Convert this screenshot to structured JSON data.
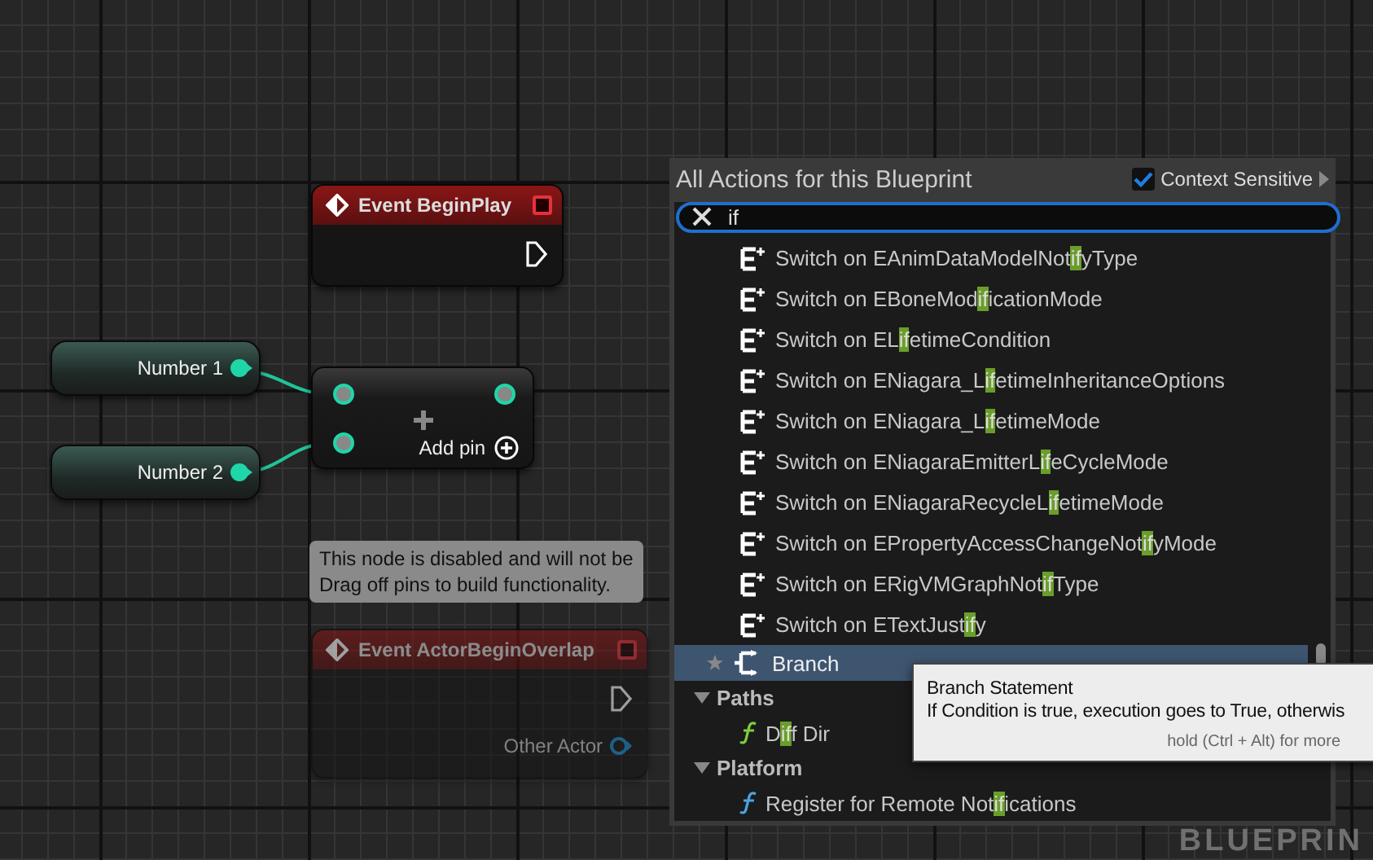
{
  "events": [
    {
      "title": "Event BeginPlay",
      "disabled": false
    },
    {
      "title": "Event ActorBeginOverlap",
      "disabled": true,
      "outputs": [
        "Other Actor"
      ]
    }
  ],
  "variables": [
    {
      "label": "Number 1"
    },
    {
      "label": "Number 2"
    }
  ],
  "add_node": {
    "label": "Add pin"
  },
  "disabled_note": {
    "lines": [
      "This node is disabled and will not be",
      "Drag off pins to build functionality."
    ]
  },
  "watermark": "BLUEPRIN",
  "action_menu": {
    "title": "All Actions for this Blueprint",
    "context_sensitive": {
      "label": "Context Sensitive",
      "checked": true
    },
    "search": {
      "value": "if"
    },
    "items": [
      {
        "kind": "switch",
        "selected": false,
        "parts": [
          "Switch on EAnimDataModelNot",
          "if",
          "yType"
        ]
      },
      {
        "kind": "switch",
        "selected": false,
        "parts": [
          "Switch on EBoneMod",
          "if",
          "icationMode"
        ]
      },
      {
        "kind": "switch",
        "selected": false,
        "parts": [
          "Switch on EL",
          "if",
          "etimeCondition"
        ]
      },
      {
        "kind": "switch",
        "selected": false,
        "parts": [
          "Switch on ENiagara_L",
          "if",
          "etimeInheritanceOptions"
        ]
      },
      {
        "kind": "switch",
        "selected": false,
        "parts": [
          "Switch on ENiagara_L",
          "if",
          "etimeMode"
        ]
      },
      {
        "kind": "switch",
        "selected": false,
        "parts": [
          "Switch on ENiagaraEmitterL",
          "if",
          "eCycleMode"
        ]
      },
      {
        "kind": "switch",
        "selected": false,
        "parts": [
          "Switch on ENiagaraRecycleL",
          "if",
          "etimeMode"
        ]
      },
      {
        "kind": "switch",
        "selected": false,
        "parts": [
          "Switch on EPropertyAccessChangeNot",
          "if",
          "yMode"
        ]
      },
      {
        "kind": "switch",
        "selected": false,
        "parts": [
          "Switch on ERigVMGraphNot",
          "if",
          "Type"
        ]
      },
      {
        "kind": "switch",
        "selected": false,
        "parts": [
          "Switch on ETextJust",
          "if",
          "y"
        ]
      },
      {
        "kind": "branch",
        "selected": true,
        "parts": [
          "Branch"
        ]
      },
      {
        "kind": "category",
        "selected": false,
        "expanded": true,
        "parts": [
          "Paths"
        ],
        "children": [
          {
            "kind": "function",
            "selected": false,
            "color": "#7ccf3c",
            "parts": [
              "D",
              "if",
              "f Dir"
            ]
          }
        ]
      },
      {
        "kind": "category",
        "selected": false,
        "expanded": true,
        "parts": [
          "Platform"
        ],
        "children": [
          {
            "kind": "function",
            "selected": false,
            "color": "#4aa3e0",
            "parts": [
              "Register for Remote Not",
              "if",
              "ications"
            ]
          }
        ]
      }
    ],
    "tooltip": {
      "title": "Branch Statement",
      "body": "If Condition is true, execution goes to True, otherwis",
      "hint": "hold (Ctrl + Alt) for more"
    }
  }
}
